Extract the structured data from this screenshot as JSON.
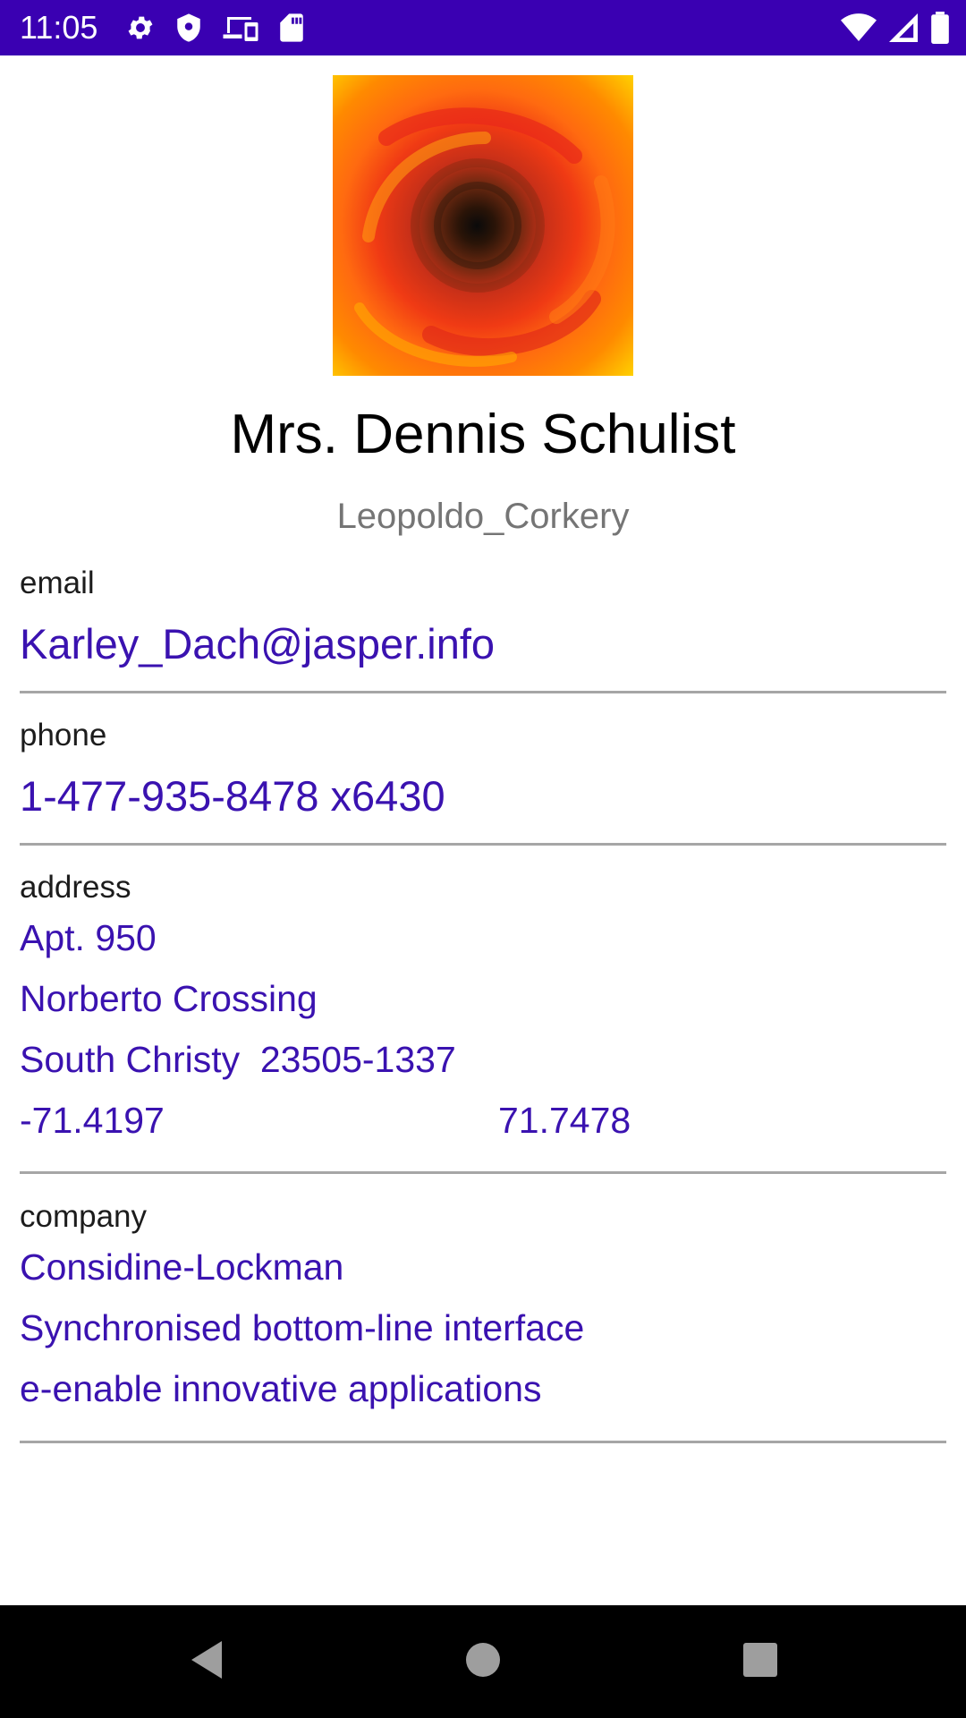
{
  "status_bar": {
    "time": "11:05",
    "left_icons": [
      "gear-icon",
      "shield-icon",
      "devices-icon",
      "sd-card-icon"
    ],
    "right_icons": [
      "wifi-icon",
      "cell-signal-icon",
      "battery-icon"
    ],
    "background": "#3a00b2"
  },
  "profile": {
    "name": "Mrs. Dennis Schulist",
    "username": "Leopoldo_Corkery"
  },
  "email": {
    "label": "email",
    "value": "Karley_Dach@jasper.info"
  },
  "phone": {
    "label": "phone",
    "value": "1-477-935-8478 x6430"
  },
  "address": {
    "label": "address",
    "suite": "Apt. 950",
    "street": "Norberto Crossing",
    "city_zip": "South Christy  23505-1337",
    "lat": "-71.4197",
    "lng": "71.7478"
  },
  "company": {
    "label": "company",
    "name": "Considine-Lockman",
    "catch_phrase": "Synchronised bottom-line interface",
    "bs": "e-enable innovative applications"
  },
  "nav_bar": {
    "buttons": [
      "back-icon",
      "home-icon",
      "recents-icon"
    ]
  },
  "colors": {
    "accent_text": "#3a12b0",
    "divider": "#a6a6a6",
    "secondary_text": "#757575"
  }
}
